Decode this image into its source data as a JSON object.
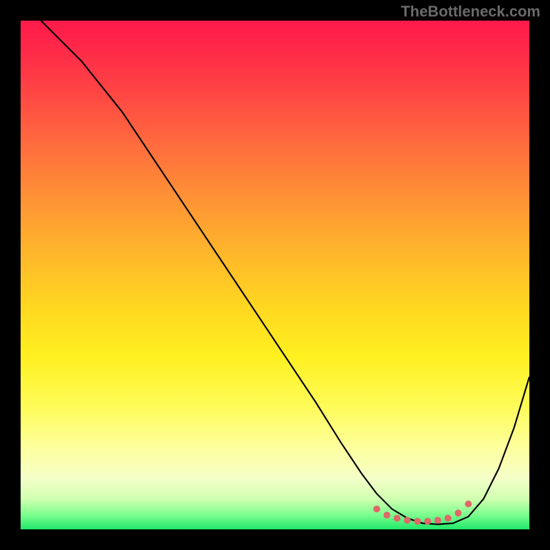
{
  "watermark": "TheBottleneck.com",
  "chart_data": {
    "type": "line",
    "title": "",
    "xlabel": "",
    "ylabel": "",
    "xlim": [
      0,
      100
    ],
    "ylim": [
      0,
      100
    ],
    "grid": false,
    "series": [
      {
        "name": "curve",
        "x": [
          4,
          8,
          12,
          20,
          28,
          36,
          44,
          52,
          58,
          63,
          67,
          70,
          73,
          76,
          79,
          82,
          85,
          88,
          91,
          94,
          97,
          100
        ],
        "y": [
          100,
          96,
          92,
          82,
          70,
          58,
          46,
          34,
          25,
          17,
          11,
          7,
          4,
          2.2,
          1.2,
          1.0,
          1.2,
          2.5,
          6,
          12,
          20,
          30
        ],
        "color": "#000000"
      }
    ],
    "markers": {
      "name": "bottom-cluster",
      "x": [
        70,
        72,
        74,
        76,
        78,
        80,
        82,
        84,
        86,
        88
      ],
      "y": [
        4.0,
        2.8,
        2.2,
        1.8,
        1.6,
        1.6,
        1.8,
        2.2,
        3.2,
        5.0
      ],
      "color": "#e06868",
      "size": 5
    },
    "background_gradient": {
      "stops": [
        {
          "pos": 0.0,
          "color": "#ff1a4a"
        },
        {
          "pos": 0.14,
          "color": "#ff4544"
        },
        {
          "pos": 0.34,
          "color": "#ff8f36"
        },
        {
          "pos": 0.56,
          "color": "#ffd620"
        },
        {
          "pos": 0.76,
          "color": "#fffc5a"
        },
        {
          "pos": 0.9,
          "color": "#f4ffc8"
        },
        {
          "pos": 0.97,
          "color": "#80ff90"
        },
        {
          "pos": 1.0,
          "color": "#20e86a"
        }
      ]
    }
  }
}
